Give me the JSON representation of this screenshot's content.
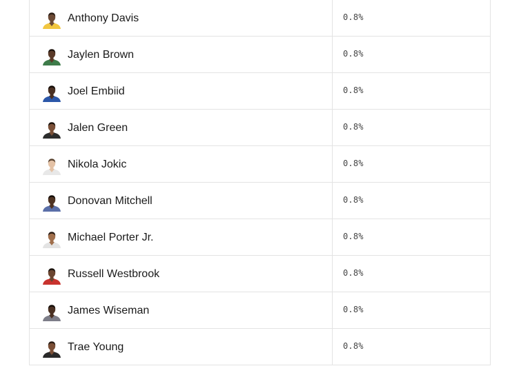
{
  "players": [
    {
      "name": "Anthony Davis",
      "pct": "0.8%",
      "skin": "#6b4a35",
      "jersey": "#f1c640",
      "hair": "#2a1c14",
      "icon": "player-headshot-icon"
    },
    {
      "name": "Jaylen Brown",
      "pct": "0.8%",
      "skin": "#5a3a28",
      "jersey": "#3e7c4a",
      "hair": "#1c120c",
      "icon": "player-headshot-icon"
    },
    {
      "name": "Joel Embiid",
      "pct": "0.8%",
      "skin": "#4a3022",
      "jersey": "#2c57a8",
      "hair": "#140d08",
      "icon": "player-headshot-icon"
    },
    {
      "name": "Jalen Green",
      "pct": "0.8%",
      "skin": "#7a5038",
      "jersey": "#2d2d2d",
      "hair": "#1a110b",
      "icon": "player-headshot-icon"
    },
    {
      "name": "Nikola Jokic",
      "pct": "0.8%",
      "skin": "#e4c2a6",
      "jersey": "#e8e8e8",
      "hair": "#5a4330",
      "icon": "player-headshot-icon"
    },
    {
      "name": "Donovan Mitchell",
      "pct": "0.8%",
      "skin": "#4f3322",
      "jersey": "#5a6fa8",
      "hair": "#140d08",
      "icon": "player-headshot-icon"
    },
    {
      "name": "Michael Porter Jr.",
      "pct": "0.8%",
      "skin": "#a06f4c",
      "jersey": "#e3e3e3",
      "hair": "#2a1c14",
      "icon": "player-headshot-icon"
    },
    {
      "name": "Russell Westbrook",
      "pct": "0.8%",
      "skin": "#6a4530",
      "jersey": "#c8332e",
      "hair": "#1a110b",
      "icon": "player-headshot-icon"
    },
    {
      "name": "James Wiseman",
      "pct": "0.8%",
      "skin": "#4a3022",
      "jersey": "#7d7d88",
      "hair": "#140d08",
      "icon": "player-headshot-icon"
    },
    {
      "name": "Trae Young",
      "pct": "0.8%",
      "skin": "#7a4e36",
      "jersey": "#2a2a2a",
      "hair": "#2a1c14",
      "icon": "player-headshot-icon"
    }
  ]
}
